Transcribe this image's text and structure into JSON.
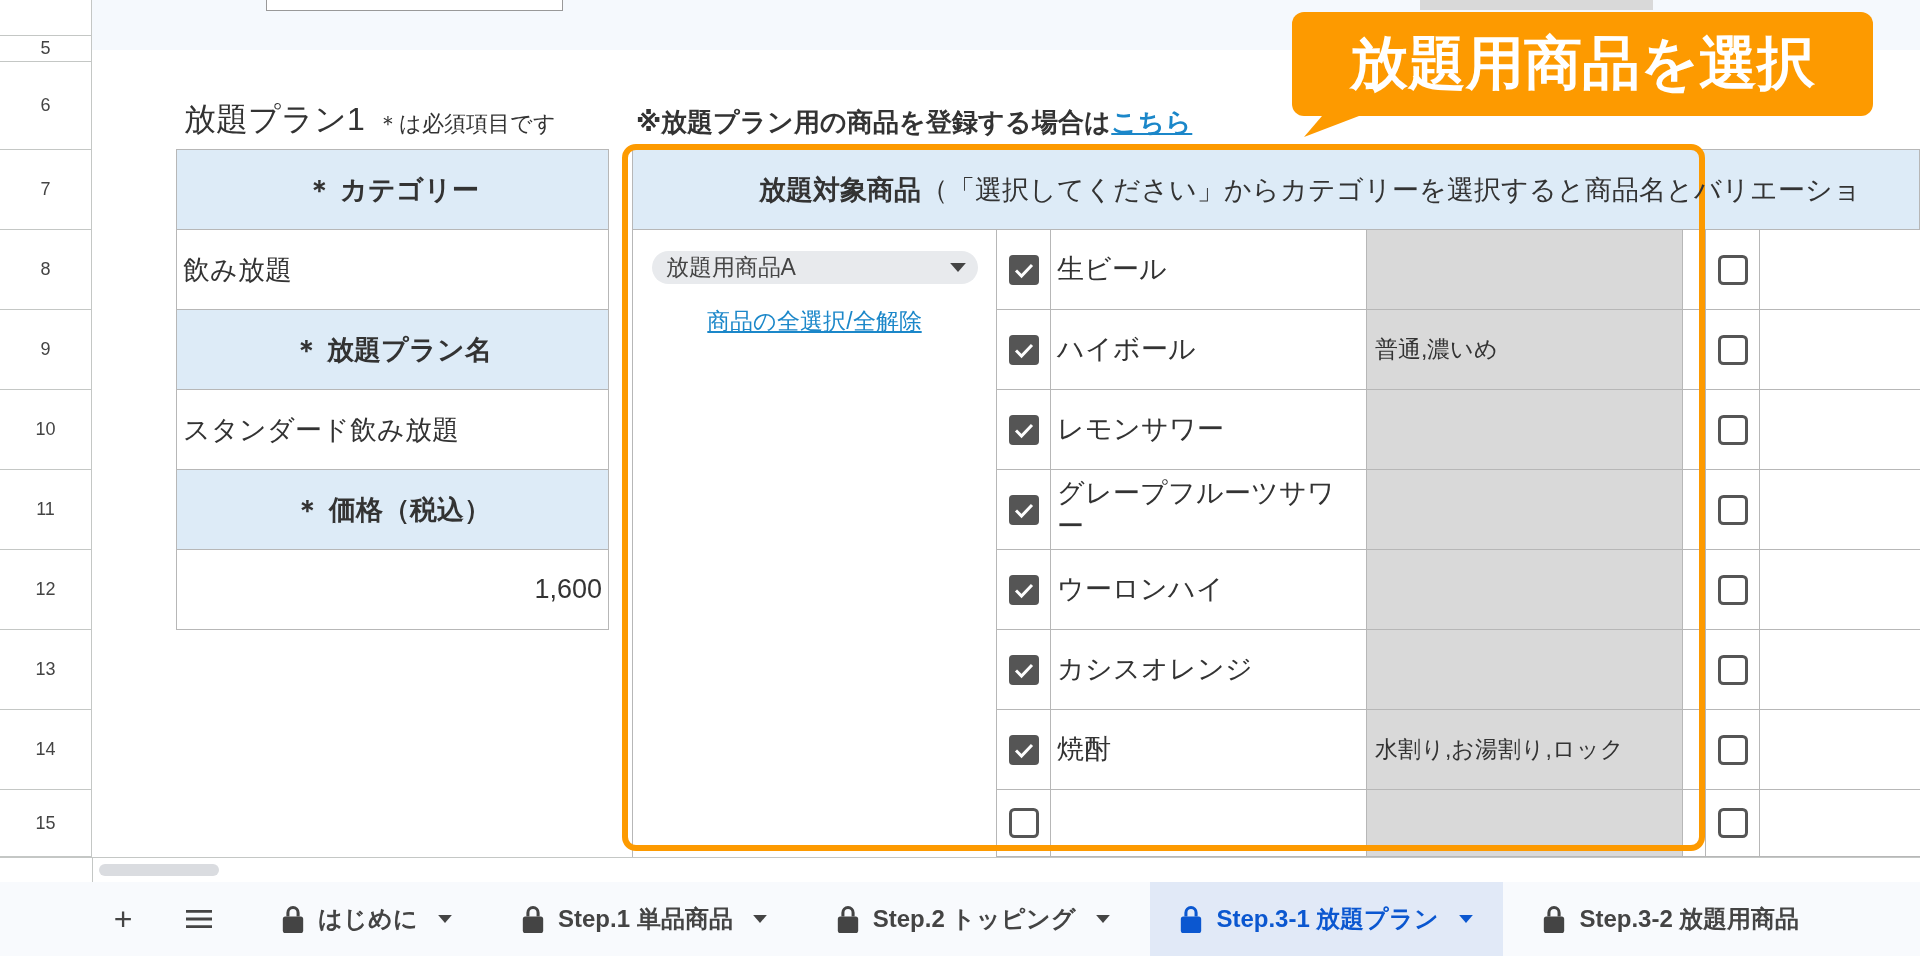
{
  "row_numbers": [
    "5",
    "6",
    "7",
    "8",
    "9",
    "10",
    "11",
    "12",
    "13",
    "14",
    "15"
  ],
  "plan_title": "放題プラン1",
  "required_note": "＊は必須項目です",
  "register_note": {
    "text": "※放題プラン用の商品を登録する場合は",
    "link": "こちら"
  },
  "plan_fields": [
    {
      "label": "＊ カテゴリー",
      "value": "飲み放題",
      "kind": "text"
    },
    {
      "label": "＊ 放題プラン名",
      "value": "スタンダード飲み放題",
      "kind": "text"
    },
    {
      "label": "＊ 価格（税込）",
      "value": "1,600",
      "kind": "number"
    }
  ],
  "products": {
    "header_title": "放題対象商品",
    "header_note": "（「選択してください」からカテゴリーを選択すると商品名とバリエーショ",
    "category_dropdown": "放題用商品A",
    "select_all_link": "商品の全選択/全解除",
    "items": [
      {
        "checked": true,
        "name": "生ビール",
        "column_5_checked": false
      },
      {
        "checked": true,
        "name": "ハイボール",
        "variation": "普通,濃いめ",
        "column_5_checked": false
      },
      {
        "checked": true,
        "name": "レモンサワー",
        "column_5_checked": false
      },
      {
        "checked": true,
        "name": "グレープフルーツサワー",
        "column_5_checked": false
      },
      {
        "checked": true,
        "name": "ウーロンハイ",
        "column_5_checked": false
      },
      {
        "checked": true,
        "name": "カシスオレンジ",
        "column_5_checked": false
      },
      {
        "checked": true,
        "name": "焼酎",
        "variation": "水割り,お湯割り,ロック",
        "column_5_checked": false
      },
      {
        "checked": false,
        "column_5_checked": false
      }
    ]
  },
  "callout": "放題用商品を選択",
  "add_sheet_button": "+",
  "sheet_tabs": [
    {
      "label": "はじめに",
      "dropdown": true,
      "selected": false
    },
    {
      "label": "Step.1 単品商品",
      "dropdown": true,
      "selected": false
    },
    {
      "label": "Step.2 トッピング",
      "dropdown": true,
      "selected": false
    },
    {
      "label": "Step.3-1 放題プラン",
      "dropdown": true,
      "selected": true
    },
    {
      "label": "Step.3-2 放題用商品",
      "dropdown": false,
      "selected": false
    }
  ]
}
